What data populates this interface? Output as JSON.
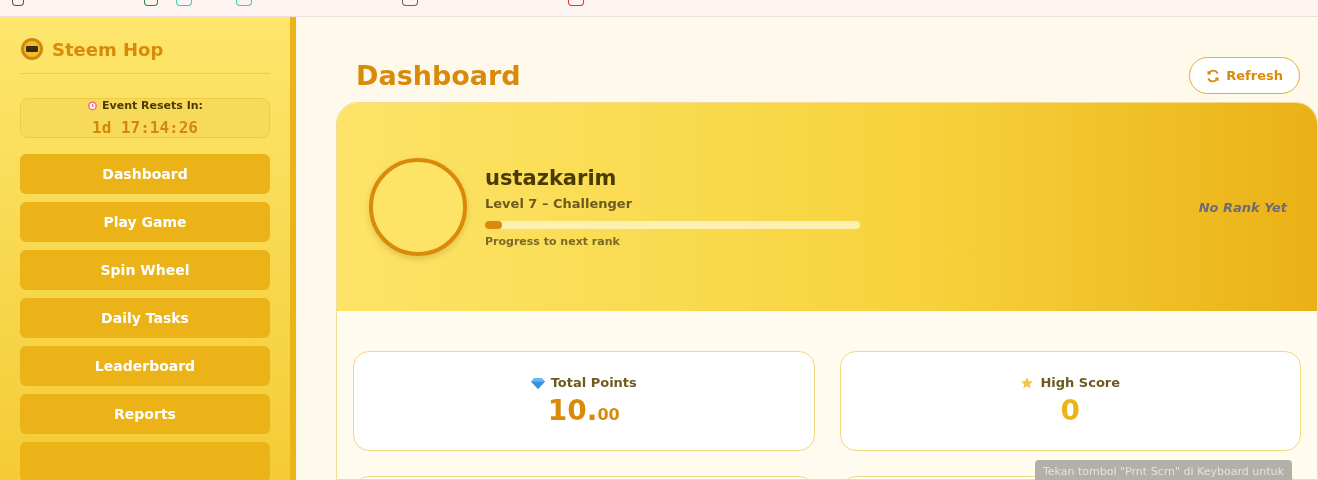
{
  "sidebar": {
    "brand": "Steem Hop",
    "timer": {
      "label": "Event Resets In:",
      "value": "1d 17:14:26"
    },
    "nav_items": [
      {
        "kind": "link",
        "label": "Dashboard"
      },
      {
        "kind": "link",
        "label": "Play Game"
      },
      {
        "kind": "link",
        "label": "Spin Wheel"
      },
      {
        "kind": "link",
        "label": "Daily Tasks"
      },
      {
        "kind": "link",
        "label": "Leaderboard"
      },
      {
        "kind": "link",
        "label": "Reports"
      },
      {
        "kind": "cut"
      }
    ]
  },
  "header": {
    "title": "Dashboard",
    "refresh_button": "Refresh"
  },
  "profile": {
    "username": "ustazkarim",
    "level_label": "Level 7 – Challenger",
    "level": 0.045,
    "progress_caption": "Progress to next rank",
    "rank": "No Rank Yet"
  },
  "stats": [
    {
      "kind": "points",
      "label": "Total Points",
      "value": "10.",
      "decimals": "00"
    },
    {
      "kind": "score",
      "label": "High Score",
      "value": "0"
    }
  ],
  "toast": "Tekan tombol \"Prnt Scrn\" di Keyboard untuk"
}
